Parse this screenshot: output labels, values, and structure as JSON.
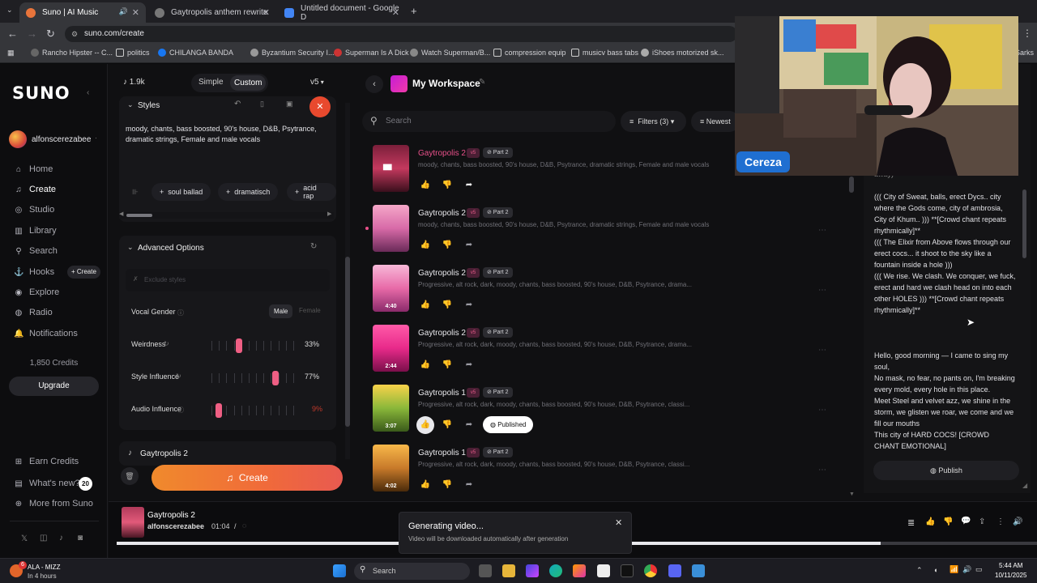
{
  "browser": {
    "tabs": [
      {
        "title": "Suno | AI Music",
        "active": true
      },
      {
        "title": "Gaytropolis anthem rewrite",
        "active": false
      },
      {
        "title": "Untitled document - Google D",
        "active": false
      }
    ],
    "new_tab": "+",
    "url": "suno.com/create",
    "bookmarks": [
      "Rancho Hipster -- C...",
      "politics",
      "CHILANGA BANDA",
      "Byzantium Security I...",
      "Superman Is A Dick",
      "Watch Superman/B...",
      "compression equip",
      "musicv bass tabs",
      "iShoes motorized sk...",
      "Sarks"
    ]
  },
  "sidebar": {
    "logo": "SUNO",
    "username": "alfonscerezabee",
    "items": [
      {
        "label": "Home",
        "icon": "home-icon"
      },
      {
        "label": "Create",
        "icon": "create-icon"
      },
      {
        "label": "Studio",
        "icon": "studio-icon"
      },
      {
        "label": "Library",
        "icon": "library-icon"
      },
      {
        "label": "Search",
        "icon": "search-icon"
      },
      {
        "label": "Hooks",
        "icon": "hooks-icon"
      },
      {
        "label": "Explore",
        "icon": "explore-icon"
      },
      {
        "label": "Radio",
        "icon": "radio-icon"
      },
      {
        "label": "Notifications",
        "icon": "bell-icon"
      }
    ],
    "hooks_create": "+ Create",
    "credits": "1,850 Credits",
    "upgrade": "Upgrade",
    "bottom": [
      {
        "label": "Earn Credits"
      },
      {
        "label": "What's new?",
        "badge": "20"
      },
      {
        "label": "More from Suno"
      }
    ]
  },
  "create_panel": {
    "credits_count": "1.9k",
    "mode_simple": "Simple",
    "mode_custom": "Custom",
    "version": "v5",
    "styles_label": "Styles",
    "styles_text": "moody, chants, bass boosted, 90's house, D&B, Psytrance, dramatic strings, Female and male vocals",
    "suggestion_chips": [
      "soul ballad",
      "dramatisch",
      "acid rap"
    ],
    "advanced_label": "Advanced Options",
    "exclude_placeholder": "Exclude styles",
    "vocal_gender_label": "Vocal Gender",
    "vocal_male": "Male",
    "vocal_female": "Female",
    "weirdness_label": "Weirdness",
    "weirdness_value": "33%",
    "style_influence_label": "Style Influence",
    "style_influence_value": "77%",
    "audio_influence_label": "Audio Influence",
    "audio_influence_value": "9%",
    "levels": {
      "weirdness": 0.33,
      "style_influence": 0.77,
      "audio_influence": 0.09
    },
    "song_name": "Gaytropolis 2",
    "create_button": "Create"
  },
  "workspace": {
    "title": "My Workspace",
    "search_placeholder": "Search",
    "filters": "Filters (3)",
    "sort": "Newest",
    "songs": [
      {
        "title": "Gaytropolis 2",
        "v": "v5",
        "part": "Part 2",
        "tags": "moody, chants, bass boosted, 90's house, D&B, Psytrance, dramatic strings, Female and male vocals",
        "duration": "",
        "playing": true,
        "liked": false,
        "published": false
      },
      {
        "title": "Gaytropolis 2",
        "v": "v5",
        "part": "Part 2",
        "tags": "moody, chants, bass boosted, 90's house, D&B, Psytrance, dramatic strings, Female and male vocals",
        "duration": "",
        "playing": false,
        "liked": false,
        "published": false
      },
      {
        "title": "Gaytropolis 2",
        "v": "v5",
        "part": "Part 2",
        "tags": "Progressive, alt rock, dark, moody, chants, bass boosted, 90's house, D&B, Psytrance, drama...",
        "duration": "4:40",
        "playing": false,
        "liked": false,
        "published": false
      },
      {
        "title": "Gaytropolis 2",
        "v": "v5",
        "part": "Part 2",
        "tags": "Progressive, alt rock, dark, moody, chants, bass boosted, 90's house, D&B, Psytrance, drama...",
        "duration": "2:44",
        "playing": false,
        "liked": false,
        "published": false
      },
      {
        "title": "Gaytropolis 1",
        "v": "v5",
        "part": "Part 2",
        "tags": "Progressive, alt rock, dark, moody, chants, bass boosted, 90's house, D&B, Psytrance, classi...",
        "duration": "3:07",
        "playing": false,
        "liked": true,
        "published": true
      },
      {
        "title": "Gaytropolis 1",
        "v": "v5",
        "part": "Part 2",
        "tags": "Progressive, alt rock, dark, moody, chants, bass boosted, 90's house, D&B, Psytrance, classi...",
        "duration": "4:02",
        "playing": false,
        "liked": false,
        "published": false
      }
    ],
    "published_label": "Published"
  },
  "lyrics": {
    "top_cut": "away)",
    "blocks": [
      "((( City of Sweat, balls, erect Dycs.. city where the Gods come, city of ambrosia, City of Khum.. ))) **[Crowd chant repeats rhythmically]**",
      "((( The Elixir from Above flows through our erect cocs... it shoot to the sky like a fountain inside a hole )))",
      "((( We rise. We clash. We conquer, we fuck, erect and hard we clash head on into each other HOLES ))) **[Crowd chant repeats rhythmically]**",
      "Hello, good morning — I came to sing my soul,",
      "No mask, no fear, no pants on, I'm breaking every mold, every hole in this place.",
      "Meet Steel and velvet azz, we shine in the storm, we glisten we roar, we come and we fill our mouths",
      "This city of HARD COCS! [CROWD CHANT EMOTIONAL]"
    ],
    "publish": "Publish"
  },
  "player": {
    "title": "Gaytropolis 2",
    "artist": "alfonscerezabee",
    "time": "01:04",
    "separator": "/",
    "progress": 0.83
  },
  "toast": {
    "title": "Generating video...",
    "message": "Video will be downloaded automatically after generation"
  },
  "webcam": {
    "name": "Cereza"
  },
  "taskbar": {
    "weather_temp": "6",
    "weather_line1": "ALA - MIZZ",
    "weather_line2": "In 4 hours",
    "search": "Search",
    "time": "5:44 AM",
    "date": "10/11/2025"
  }
}
